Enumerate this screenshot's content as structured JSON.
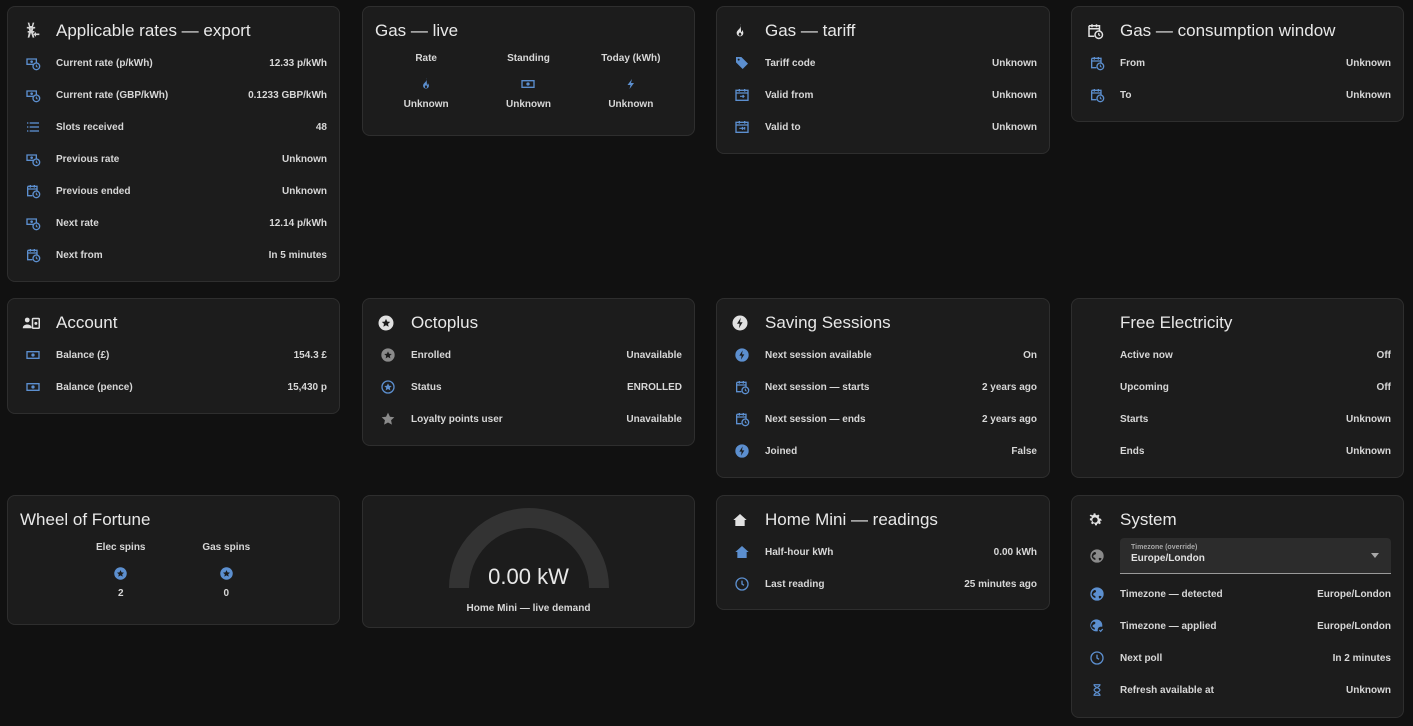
{
  "colors": {
    "accent": "#5c8fcf",
    "grey_icon": "#8a8a8a",
    "card_bg": "#1c1c1c",
    "page_bg": "#111111"
  },
  "export_rates": {
    "title": "Applicable rates — export",
    "icon": "transmission-tower-export-icon",
    "rows": [
      {
        "label": "Current rate (p/kWh)",
        "value": "12.33 p/kWh",
        "icon": "cash-clock-icon"
      },
      {
        "label": "Current rate (GBP/kWh)",
        "value": "0.1233 GBP/kWh",
        "icon": "cash-clock-icon"
      },
      {
        "label": "Slots received",
        "value": "48",
        "icon": "format-list-icon"
      },
      {
        "label": "Previous rate",
        "value": "Unknown",
        "icon": "cash-clock-icon"
      },
      {
        "label": "Previous ended",
        "value": "Unknown",
        "icon": "calendar-clock-icon"
      },
      {
        "label": "Next rate",
        "value": "12.14 p/kWh",
        "icon": "cash-clock-icon"
      },
      {
        "label": "Next from",
        "value": "In 5 minutes",
        "icon": "calendar-clock-icon"
      }
    ]
  },
  "gas_live": {
    "title": "Gas — live",
    "items": [
      {
        "name": "Rate",
        "value": "Unknown",
        "icon": "fire-icon"
      },
      {
        "name": "Standing",
        "value": "Unknown",
        "icon": "cash-icon"
      },
      {
        "name": "Today (kWh)",
        "value": "Unknown",
        "icon": "lightning-icon"
      }
    ]
  },
  "gas_tariff": {
    "title": "Gas — tariff",
    "icon": "fire-icon",
    "rows": [
      {
        "label": "Tariff code",
        "value": "Unknown",
        "icon": "tag-icon"
      },
      {
        "label": "Valid from",
        "value": "Unknown",
        "icon": "calendar-start-icon"
      },
      {
        "label": "Valid to",
        "value": "Unknown",
        "icon": "calendar-end-icon"
      }
    ]
  },
  "gas_window": {
    "title": "Gas — consumption window",
    "icon": "calendar-clock-icon",
    "rows": [
      {
        "label": "From",
        "value": "Unknown",
        "icon": "calendar-clock-icon"
      },
      {
        "label": "To",
        "value": "Unknown",
        "icon": "calendar-clock-icon"
      }
    ]
  },
  "account": {
    "title": "Account",
    "icon": "account-cash-icon",
    "rows": [
      {
        "label": "Balance (£)",
        "value": "154.3 £",
        "icon": "cash-icon"
      },
      {
        "label": "Balance (pence)",
        "value": "15,430 p",
        "icon": "cash-icon"
      }
    ]
  },
  "octoplus": {
    "title": "Octoplus",
    "icon": "star-circle-icon",
    "rows": [
      {
        "label": "Enrolled",
        "value": "Unavailable",
        "icon": "star-circle-icon"
      },
      {
        "label": "Status",
        "value": "ENROLLED",
        "icon": "star-circle-outline-icon"
      },
      {
        "label": "Loyalty points user",
        "value": "Unavailable",
        "icon": "star-icon"
      }
    ]
  },
  "saving_sessions": {
    "title": "Saving Sessions",
    "icon": "lightning-circle-icon",
    "rows": [
      {
        "label": "Next session available",
        "value": "On",
        "icon": "lightning-circle-icon"
      },
      {
        "label": "Next session — starts",
        "value": "2 years ago",
        "icon": "calendar-clock-icon"
      },
      {
        "label": "Next session — ends",
        "value": "2 years ago",
        "icon": "calendar-clock-icon"
      },
      {
        "label": "Joined",
        "value": "False",
        "icon": "lightning-circle-icon"
      }
    ]
  },
  "free_electricity": {
    "title": "Free Electricity",
    "rows": [
      {
        "label": "Active now",
        "value": "Off"
      },
      {
        "label": "Upcoming",
        "value": "Off"
      },
      {
        "label": "Starts",
        "value": "Unknown"
      },
      {
        "label": "Ends",
        "value": "Unknown"
      }
    ]
  },
  "wheel": {
    "title": "Wheel of Fortune",
    "items": [
      {
        "name": "Elec spins",
        "value": "2",
        "icon": "star-circle-icon"
      },
      {
        "name": "Gas spins",
        "value": "0",
        "icon": "star-circle-icon"
      }
    ]
  },
  "gauge": {
    "value": "0.00 kW",
    "name": "Home Mini — live demand",
    "fill_fraction": 0
  },
  "home_mini": {
    "title": "Home Mini — readings",
    "icon": "home-lightning-icon",
    "rows": [
      {
        "label": "Half-hour kWh",
        "value": "0.00 kWh",
        "icon": "home-lightning-icon"
      },
      {
        "label": "Last reading",
        "value": "25 minutes ago",
        "icon": "clock-icon"
      }
    ]
  },
  "system": {
    "title": "System",
    "icon": "gear-icon",
    "timezone_select": {
      "label": "Timezone (override)",
      "value": "Europe/London",
      "icon": "globe-icon"
    },
    "rows": [
      {
        "label": "Timezone — detected",
        "value": "Europe/London",
        "icon": "globe-icon"
      },
      {
        "label": "Timezone — applied",
        "value": "Europe/London",
        "icon": "globe-check-icon"
      },
      {
        "label": "Next poll",
        "value": "In 2 minutes",
        "icon": "clock-icon"
      },
      {
        "label": "Refresh available at",
        "value": "Unknown",
        "icon": "hourglass-icon"
      }
    ]
  }
}
